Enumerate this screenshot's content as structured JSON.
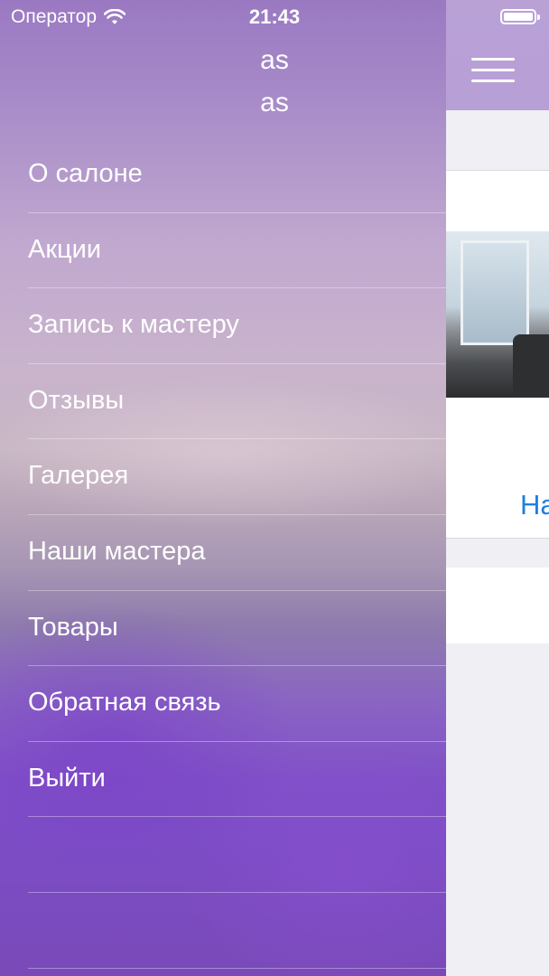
{
  "status_bar": {
    "carrier": "Оператор",
    "time": "21:43",
    "wifi_icon": "wifi-icon",
    "battery_icon": "battery-icon"
  },
  "drawer": {
    "user_name": "as",
    "user_subtitle": "as",
    "menu_items": [
      {
        "label": "О салоне"
      },
      {
        "label": "Акции"
      },
      {
        "label": "Запись к мастеру"
      },
      {
        "label": "Отзывы"
      },
      {
        "label": "Галерея"
      },
      {
        "label": "Наши мастера"
      },
      {
        "label": "Товары"
      },
      {
        "label": "Обратная связь"
      },
      {
        "label": "Выйти"
      },
      {
        "label": ""
      },
      {
        "label": ""
      }
    ]
  },
  "main": {
    "menu_icon": "hamburger-menu-icon",
    "link_text_partial": "На",
    "accent_color": "#1f7fe0",
    "navbar_color": "#b9a1d6"
  }
}
